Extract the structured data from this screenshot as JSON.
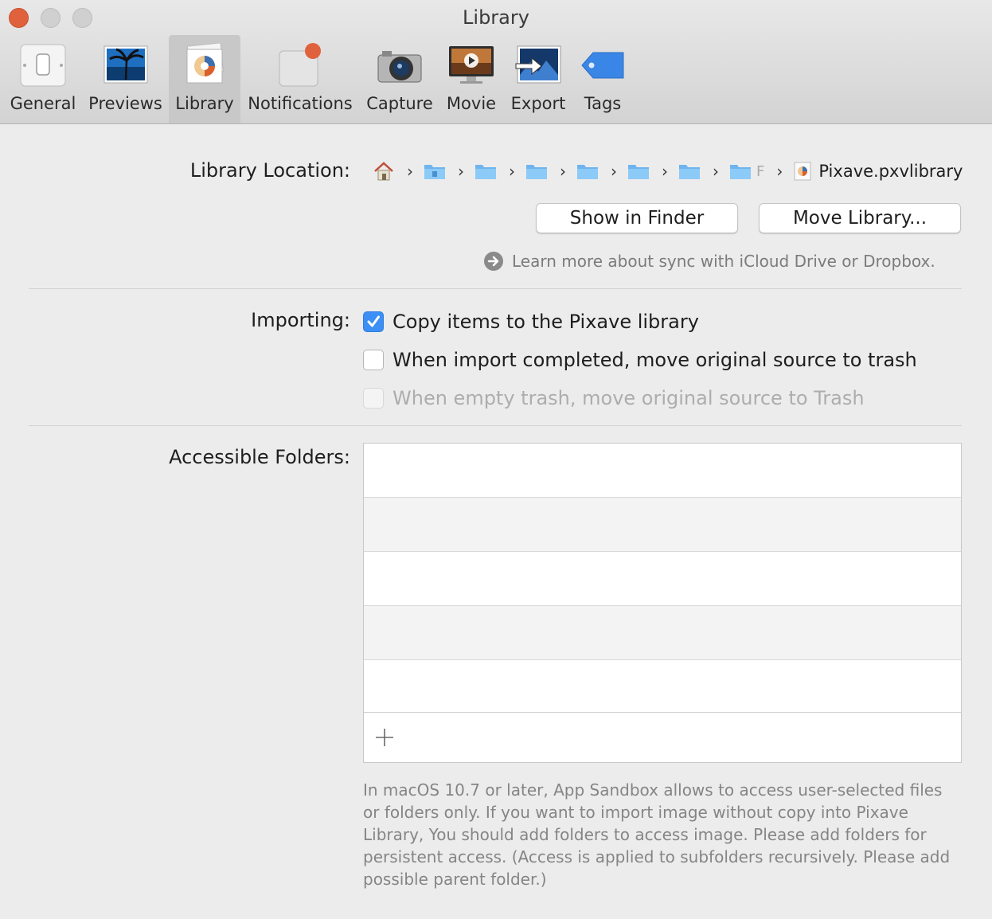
{
  "window": {
    "title": "Library"
  },
  "toolbar": {
    "tabs": [
      {
        "label": "General"
      },
      {
        "label": "Previews"
      },
      {
        "label": "Library"
      },
      {
        "label": "Notifications"
      },
      {
        "label": "Capture"
      },
      {
        "label": "Movie"
      },
      {
        "label": "Export"
      },
      {
        "label": "Tags"
      }
    ],
    "selected": "Library"
  },
  "library_location": {
    "label": "Library Location:",
    "path_truncated_text": "F",
    "file_name": "Pixave.pxvlibrary",
    "show_in_finder": "Show in Finder",
    "move_library": "Move Library...",
    "learn_more": "Learn more about sync with iCloud Drive or Dropbox."
  },
  "importing": {
    "label": "Importing:",
    "options": [
      {
        "label": "Copy items to the Pixave library",
        "checked": true,
        "enabled": true
      },
      {
        "label": "When import completed, move original source to trash",
        "checked": false,
        "enabled": true
      },
      {
        "label": "When empty trash, move original source to Trash",
        "checked": false,
        "enabled": false
      }
    ]
  },
  "accessible_folders": {
    "label": "Accessible Folders:",
    "items": [],
    "note": "In macOS 10.7 or later, App Sandbox allows to access user-selected files or folders only. If you want to import image without copy into Pixave Library, You should add folders to access image. Please add folders for persistent access. (Access is applied to subfolders recursively. Please add possible parent folder.)"
  },
  "colors": {
    "accent": "#3b8ff5",
    "close_button": "#e0623d",
    "folder_icon": "#6fb4ee"
  },
  "icons": [
    "home-icon",
    "folder-icon",
    "package-icon",
    "chevron-right-icon",
    "arrow-right-circle-icon",
    "plus-icon"
  ]
}
